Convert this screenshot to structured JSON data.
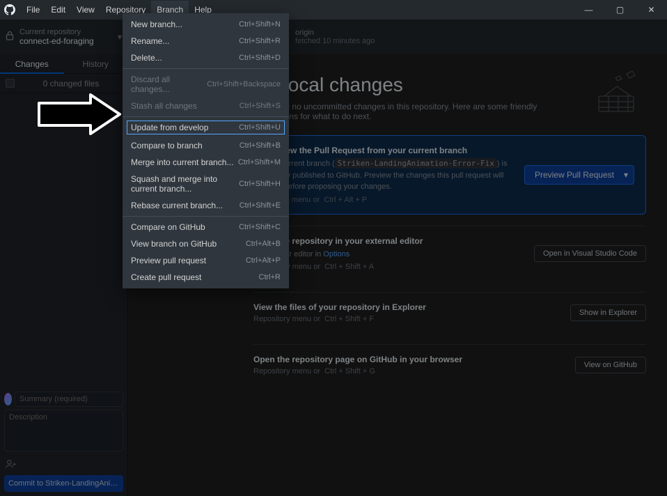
{
  "menubar": {
    "items": [
      "File",
      "Edit",
      "View",
      "Repository",
      "Branch",
      "Help"
    ],
    "active_index": 4
  },
  "window_controls": {
    "min": "—",
    "max": "▢",
    "close": "✕"
  },
  "repo_selector": {
    "label": "Current repository",
    "name": "connect-ed-foraging"
  },
  "origin": {
    "label": "origin",
    "subtitle": "fetched 10 minutes ago"
  },
  "sidebar": {
    "tabs": {
      "changes": "Changes",
      "history": "History"
    },
    "file_count": "0 changed files",
    "summary_placeholder": "Summary (required)",
    "description_placeholder": "Description",
    "coauthor_glyph": "⎯⁺",
    "commit_btn": "Commit to Striken-LandingAnimati..."
  },
  "dropdown": {
    "groups": [
      [
        {
          "label": "New branch...",
          "shortcut": "Ctrl+Shift+N",
          "disabled": false
        },
        {
          "label": "Rename...",
          "shortcut": "Ctrl+Shift+R",
          "disabled": false
        },
        {
          "label": "Delete...",
          "shortcut": "Ctrl+Shift+D",
          "disabled": false
        }
      ],
      [
        {
          "label": "Discard all changes...",
          "shortcut": "Ctrl+Shift+Backspace",
          "disabled": true
        },
        {
          "label": "Stash all changes",
          "shortcut": "Ctrl+Shift+S",
          "disabled": true
        }
      ],
      [
        {
          "label": "Update from develop",
          "shortcut": "Ctrl+Shift+U",
          "disabled": false,
          "highlighted": true
        },
        {
          "label": "Compare to branch",
          "shortcut": "Ctrl+Shift+B",
          "disabled": false
        },
        {
          "label": "Merge into current branch...",
          "shortcut": "Ctrl+Shift+M",
          "disabled": false
        },
        {
          "label": "Squash and merge into current branch...",
          "shortcut": "Ctrl+Shift+H",
          "disabled": false
        },
        {
          "label": "Rebase current branch...",
          "shortcut": "Ctrl+Shift+E",
          "disabled": false
        }
      ],
      [
        {
          "label": "Compare on GitHub",
          "shortcut": "Ctrl+Shift+C",
          "disabled": false
        },
        {
          "label": "View branch on GitHub",
          "shortcut": "Ctrl+Alt+B",
          "disabled": false
        },
        {
          "label": "Preview pull request",
          "shortcut": "Ctrl+Alt+P",
          "disabled": false
        },
        {
          "label": "Create pull request",
          "shortcut": "Ctrl+R",
          "disabled": false
        }
      ]
    ]
  },
  "content": {
    "heading": "No local changes",
    "subtitle_pre": "There are no uncommitted changes in this repository. Here are some friendly suggestions for what to do next.",
    "pr_card": {
      "title": "Preview the Pull Request from your current branch",
      "desc_1": "The current branch (",
      "branch_code": "Striken-LandingAnimation-Error-Fix",
      "desc_2": ") is already published to GitHub. Preview the changes this pull request will have before proposing your changes.",
      "hint_pre": "Branch menu or",
      "hint_kbd": "Ctrl  +  Alt  +  P",
      "button": "Preview Pull Request"
    },
    "editor_card": {
      "title": "Open the repository in your external editor",
      "desc_1": "Select your editor in ",
      "link": "Options",
      "hint_pre": "Repository menu or",
      "hint_kbd": "Ctrl  +  Shift  +  A",
      "button": "Open in Visual Studio Code"
    },
    "explorer_card": {
      "title": "View the files of your repository in Explorer",
      "hint_pre": "Repository menu or",
      "hint_kbd": "Ctrl  +  Shift  +  F",
      "button": "Show in Explorer"
    },
    "github_card": {
      "title": "Open the repository page on GitHub in your browser",
      "hint_pre": "Repository menu or",
      "hint_kbd": "Ctrl  +  Shift  +  G",
      "button": "View on GitHub"
    }
  }
}
